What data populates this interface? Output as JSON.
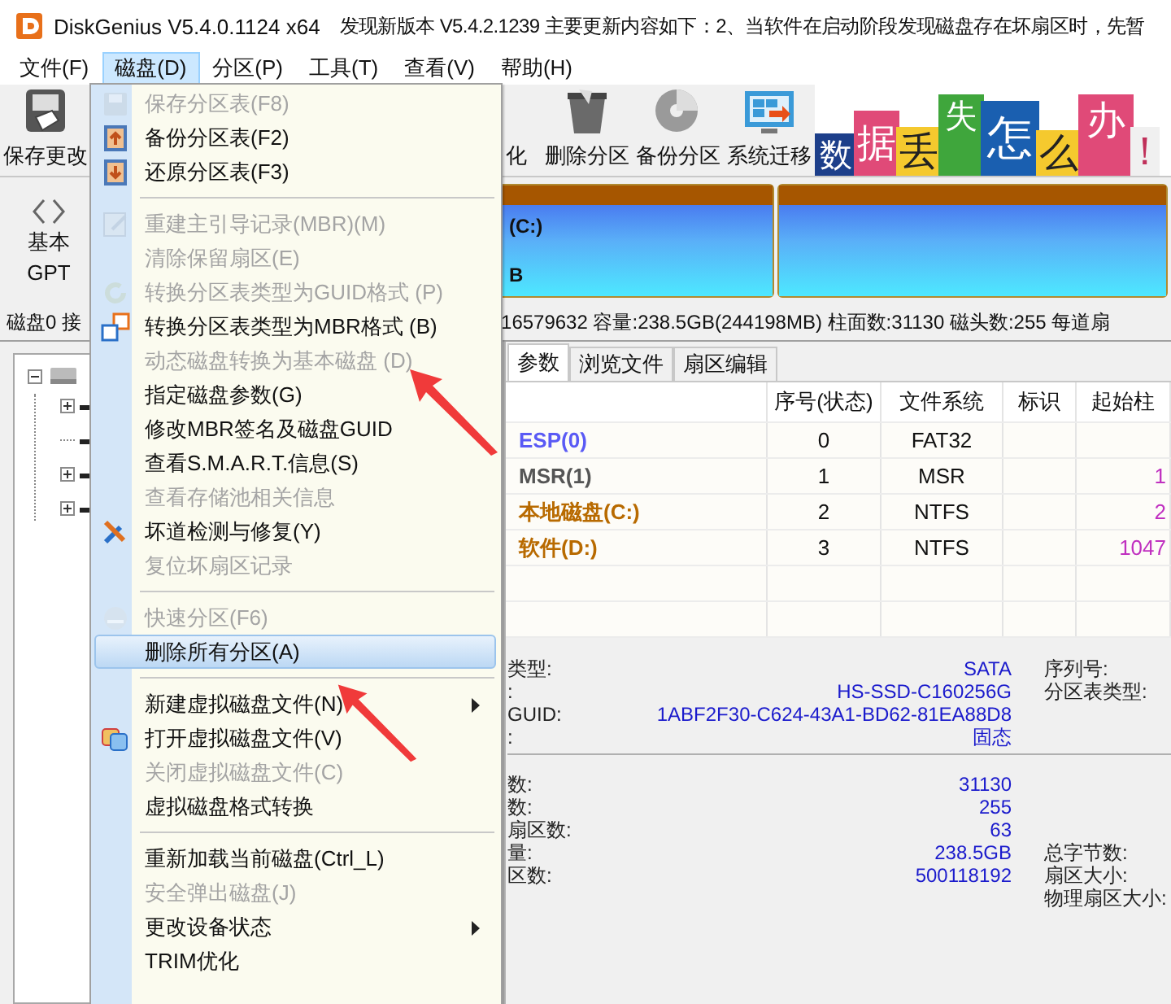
{
  "window": {
    "title": "DiskGenius V5.4.0.1124 x64",
    "notice": "发现新版本 V5.4.2.1239 主要更新内容如下：2、当软件在启动阶段发现磁盘存在坏扇区时，先暂"
  },
  "menu_bar": [
    {
      "label": "文件(F)",
      "selected": false
    },
    {
      "label": "磁盘(D)",
      "selected": true
    },
    {
      "label": "分区(P)",
      "selected": false
    },
    {
      "label": "工具(T)",
      "selected": false
    },
    {
      "label": "查看(V)",
      "selected": false
    },
    {
      "label": "帮助(H)",
      "selected": false
    }
  ],
  "toolbar": [
    {
      "kind": "save",
      "label": "保存更改"
    },
    {
      "kind": "format",
      "label": "化"
    },
    {
      "kind": "delete",
      "label": "删除分区"
    },
    {
      "kind": "backup",
      "label": "备份分区"
    },
    {
      "kind": "migrate",
      "label": "系统迁移"
    }
  ],
  "banner": [
    {
      "text": "数",
      "color": "#1d3f8a"
    },
    {
      "text": "据",
      "color": "#e04a78"
    },
    {
      "text": "丢",
      "color": "#f5c92e"
    },
    {
      "text": "失",
      "color": "#3fa63c"
    },
    {
      "text": "怎",
      "color": "#1a5fb0"
    },
    {
      "text": "么",
      "color": "#f5c92e"
    },
    {
      "text": "办",
      "color": "#e04a78"
    },
    {
      "text": "！",
      "color": "#f0f0f0"
    }
  ],
  "disk_nav": {
    "line_1": "基本",
    "line_2": "GPT"
  },
  "partitions": [
    {
      "kind": "partition",
      "label": "(C:)",
      "size": "B"
    },
    {
      "kind": "partition"
    }
  ],
  "disk_info": {
    "left": "磁盘0 接",
    "right": "16579632  容量:238.5GB(244198MB)  柱面数:31130  磁头数:255  每道扇"
  },
  "tree": {
    "expanded": true,
    "children": [
      {
        "expandable": true,
        "expanded": false
      },
      {
        "expandable": false
      },
      {
        "expandable": true,
        "expanded": false
      },
      {
        "expandable": true,
        "expanded": false
      }
    ]
  },
  "tabs": [
    {
      "label": "参数",
      "selected": true
    },
    {
      "label": "浏览文件",
      "selected": false
    },
    {
      "label": "扇区编辑",
      "selected": false
    }
  ],
  "table": {
    "columns": [
      "序号(状态)",
      "文件系统",
      "标识",
      "起始柱"
    ],
    "rows": [
      {
        "name": "ESP(0)",
        "color": "#5a5af5",
        "number": "0",
        "file_system": "FAT32"
      },
      {
        "name": "MSR(1)",
        "color": "#555555",
        "number": "1",
        "file_system": "MSR",
        "start": "1"
      },
      {
        "name": "本地磁盘(C:)",
        "color": "#b86a00",
        "number": "2",
        "file_system": "NTFS",
        "start": "2"
      },
      {
        "name": "软件(D:)",
        "color": "#b86a00",
        "number": "3",
        "file_system": "NTFS",
        "start": "1047"
      }
    ]
  },
  "details": [
    [
      {
        "label": "类型:",
        "value": "SATA",
        "right_label": "序列号:"
      },
      {
        "label": ":",
        "value": "HS-SSD-C160256G",
        "right_label": "分区表类型:"
      },
      {
        "label": " GUID:",
        "value": "1ABF2F30-C624-43A1-BD62-81EA88D8"
      },
      {
        "label": ":",
        "value": "固态"
      }
    ],
    [
      {
        "label": "数:",
        "value": "31130"
      },
      {
        "label": "数:",
        "value": "255"
      },
      {
        "label": "扇区数:",
        "value": "63"
      },
      {
        "label": "量:",
        "value": "238.5GB",
        "right_label": "总字节数:"
      },
      {
        "label": "区数:",
        "value": "500118192",
        "right_label": "扇区大小:"
      },
      {
        "right_label": "物理扇区大小:"
      }
    ]
  ],
  "disk_menu": [
    {
      "kind": "save",
      "label": "保存分区表(F8)",
      "disabled": true
    },
    {
      "kind": "backup",
      "label": "备份分区表(F2)",
      "disabled": false
    },
    {
      "kind": "restore",
      "label": "还原分区表(F3)",
      "disabled": false
    },
    {
      "kind": "separator"
    },
    {
      "kind": "rebuild",
      "label": "重建主引导记录(MBR)(M)",
      "disabled": true
    },
    {
      "kind": "plain",
      "label": "清除保留扇区(E)",
      "disabled": true
    },
    {
      "kind": "refresh",
      "label": "转换分区表类型为GUID格式 (P)",
      "disabled": true
    },
    {
      "kind": "convert",
      "label": "转换分区表类型为MBR格式 (B)",
      "disabled": false
    },
    {
      "kind": "plain",
      "label": "动态磁盘转换为基本磁盘 (D)",
      "disabled": true
    },
    {
      "kind": "plain",
      "label": "指定磁盘参数(G)",
      "disabled": false
    },
    {
      "kind": "plain",
      "label": "修改MBR签名及磁盘GUID",
      "disabled": false
    },
    {
      "kind": "plain",
      "label": "查看S.M.A.R.T.信息(S)",
      "disabled": false
    },
    {
      "kind": "plain",
      "label": "查看存储池相关信息",
      "disabled": true
    },
    {
      "kind": "repair",
      "label": "坏道检测与修复(Y)",
      "disabled": false
    },
    {
      "kind": "plain",
      "label": "复位坏扇区记录",
      "disabled": true
    },
    {
      "kind": "separator"
    },
    {
      "kind": "quick",
      "label": "快速分区(F6)",
      "disabled": true
    },
    {
      "kind": "plain",
      "label": "删除所有分区(A)",
      "disabled": false,
      "selected": true
    },
    {
      "kind": "separator"
    },
    {
      "kind": "plain",
      "label": "新建虚拟磁盘文件(N)",
      "disabled": false,
      "submenu": true
    },
    {
      "kind": "open",
      "label": "打开虚拟磁盘文件(V)",
      "disabled": false
    },
    {
      "kind": "plain",
      "label": "关闭虚拟磁盘文件(C)",
      "disabled": true
    },
    {
      "kind": "plain",
      "label": "虚拟磁盘格式转换",
      "disabled": false
    },
    {
      "kind": "separator"
    },
    {
      "kind": "plain",
      "label": "重新加载当前磁盘(Ctrl_L)",
      "disabled": false
    },
    {
      "kind": "plain",
      "label": "安全弹出磁盘(J)",
      "disabled": true
    },
    {
      "kind": "plain",
      "label": "更改设备状态",
      "disabled": false,
      "submenu": true
    },
    {
      "kind": "plain",
      "label": "TRIM优化",
      "disabled": false
    }
  ],
  "annotations": [
    {
      "kind": "arrow"
    },
    {
      "kind": "arrow"
    }
  ]
}
